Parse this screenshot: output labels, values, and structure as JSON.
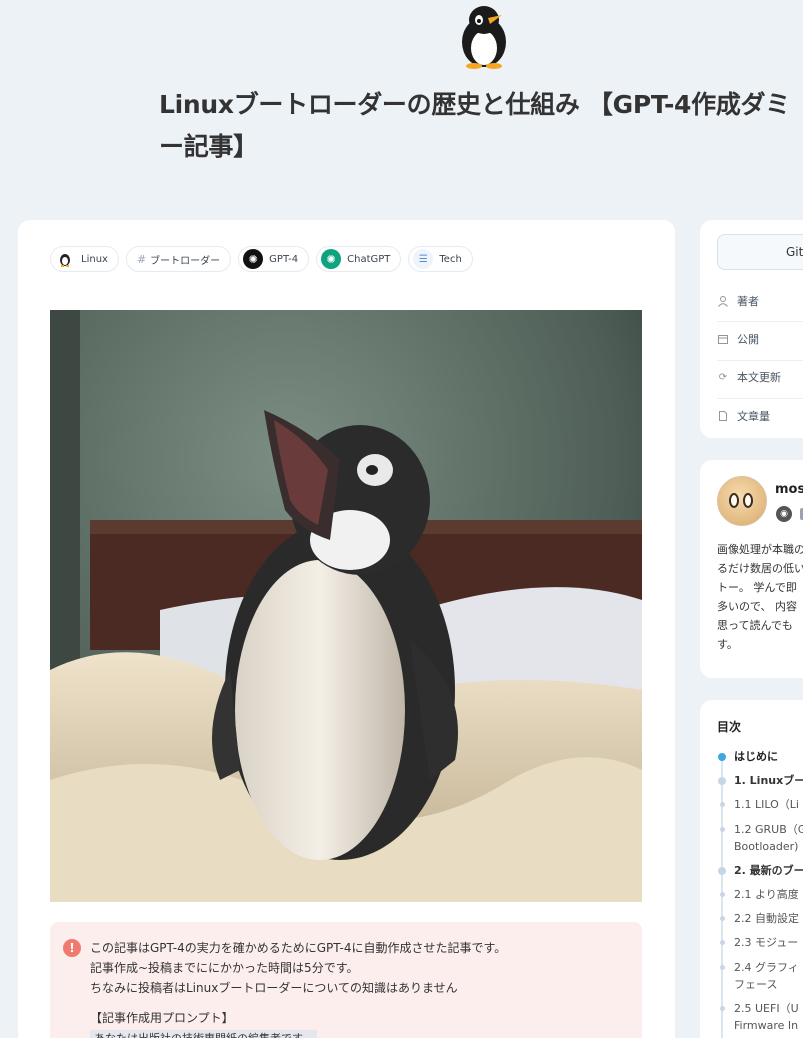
{
  "article": {
    "title": "Linuxブートローダーの歴史と仕組み 【GPT-4作成ダミー記事】"
  },
  "topics": [
    {
      "label": "Linux",
      "icon": "penguin-icon"
    },
    {
      "label": "ブートローダー",
      "icon": "hash-icon"
    },
    {
      "label": "GPT-4",
      "icon": "openai-icon"
    },
    {
      "label": "ChatGPT",
      "icon": "openai-icon"
    },
    {
      "label": "Tech",
      "icon": "tech-icon"
    }
  ],
  "notice": {
    "lines": [
      "この記事はGPT-4の実力を確かめるためにGPT-4に自動作成させた記事です。",
      "記事作成~投稿までににかかった時間は5分です。",
      "ちなみに投稿者はLinuxブートローダーについての知識はありません"
    ],
    "prompt_heading": "【記事作成用プロンプト】",
    "prompt_first_line": "あなたは出版社の技術専門紙の編集者です。"
  },
  "sidebar": {
    "github_label": "Git",
    "meta": [
      {
        "label": "著者",
        "icon": "person-icon"
      },
      {
        "label": "公開",
        "icon": "calendar-icon"
      },
      {
        "label": "本文更新",
        "icon": "refresh-icon"
      },
      {
        "label": "文章量",
        "icon": "document-icon"
      }
    ],
    "author": {
      "name": "mos",
      "bio_lines": [
        "画像処理が本職の",
        "るだけ数居の低い",
        "トー。 学んで即",
        "多いので、 内容",
        "思って読んでも",
        "す。"
      ]
    },
    "toc": {
      "title": "目次",
      "items": [
        {
          "label": "はじめに",
          "style": "active"
        },
        {
          "label": "1. Linuxブー",
          "style": "bold"
        },
        {
          "label": "1.1 LILO（Li",
          "style": "normal"
        },
        {
          "label": "1.2 GRUB（G",
          "style": "normal"
        },
        {
          "label": "Bootloader)",
          "style": "cont"
        },
        {
          "label": "2. 最新のブー",
          "style": "bold"
        },
        {
          "label": "2.1 より高度",
          "style": "normal"
        },
        {
          "label": "2.2 自動設定",
          "style": "normal"
        },
        {
          "label": "2.3 モジュー",
          "style": "normal"
        },
        {
          "label": "2.4 グラフィ",
          "style": "normal"
        },
        {
          "label": "フェース",
          "style": "cont"
        },
        {
          "label": "2.5 UEFI（U",
          "style": "normal"
        },
        {
          "label": "Firmware In",
          "style": "cont"
        }
      ]
    }
  },
  "colors": {
    "background": "#edf2f7",
    "notice_bg": "#fdeeee",
    "notice_icon": "#ef7a6d",
    "toc_active": "#3ea8de"
  }
}
